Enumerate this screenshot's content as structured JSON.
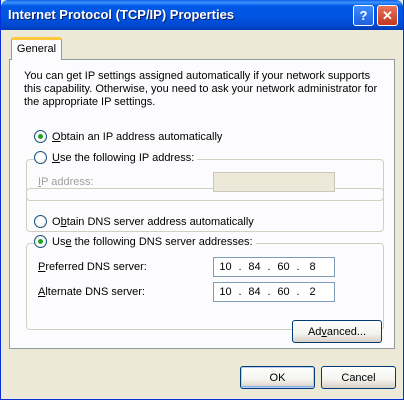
{
  "window": {
    "title": "Internet Protocol (TCP/IP) Properties",
    "help_label": "?",
    "close_label": "✕"
  },
  "tabs": [
    {
      "label": "General",
      "active": true
    }
  ],
  "intro_text": "You can get IP settings assigned automatically if your network supports this capability. Otherwise, you need to ask your network administrator for the appropriate IP settings.",
  "ip_section": {
    "auto": {
      "accel": "O",
      "rest": "btain an IP address automatically",
      "selected": true
    },
    "manual": {
      "accel": "U",
      "rest": "se the following IP address:",
      "selected": false
    },
    "ip_address": {
      "accel": "I",
      "rest": "P address:",
      "disabled": true
    }
  },
  "dns_section": {
    "auto": {
      "pre": "O",
      "accel": "b",
      "rest": "tain DNS server address automatically",
      "selected": false
    },
    "manual": {
      "pre": "Us",
      "accel": "e",
      "rest": " the following DNS server addresses:",
      "selected": true
    },
    "preferred": {
      "accel": "P",
      "rest": "referred DNS server:",
      "octets": [
        "10",
        "84",
        "60",
        "8"
      ]
    },
    "alternate": {
      "accel": "A",
      "rest": "lternate DNS server:",
      "octets": [
        "10",
        "84",
        "60",
        "2"
      ]
    }
  },
  "buttons": {
    "advanced": {
      "pre": "Ad",
      "accel": "v",
      "rest": "anced..."
    },
    "ok": "OK",
    "cancel": "Cancel"
  },
  "colors": {
    "titlebar": "#0058E6",
    "dialog_bg": "#ECE9D8",
    "tab_highlight": "#FFC83C",
    "radio_dot": "#21A121"
  }
}
